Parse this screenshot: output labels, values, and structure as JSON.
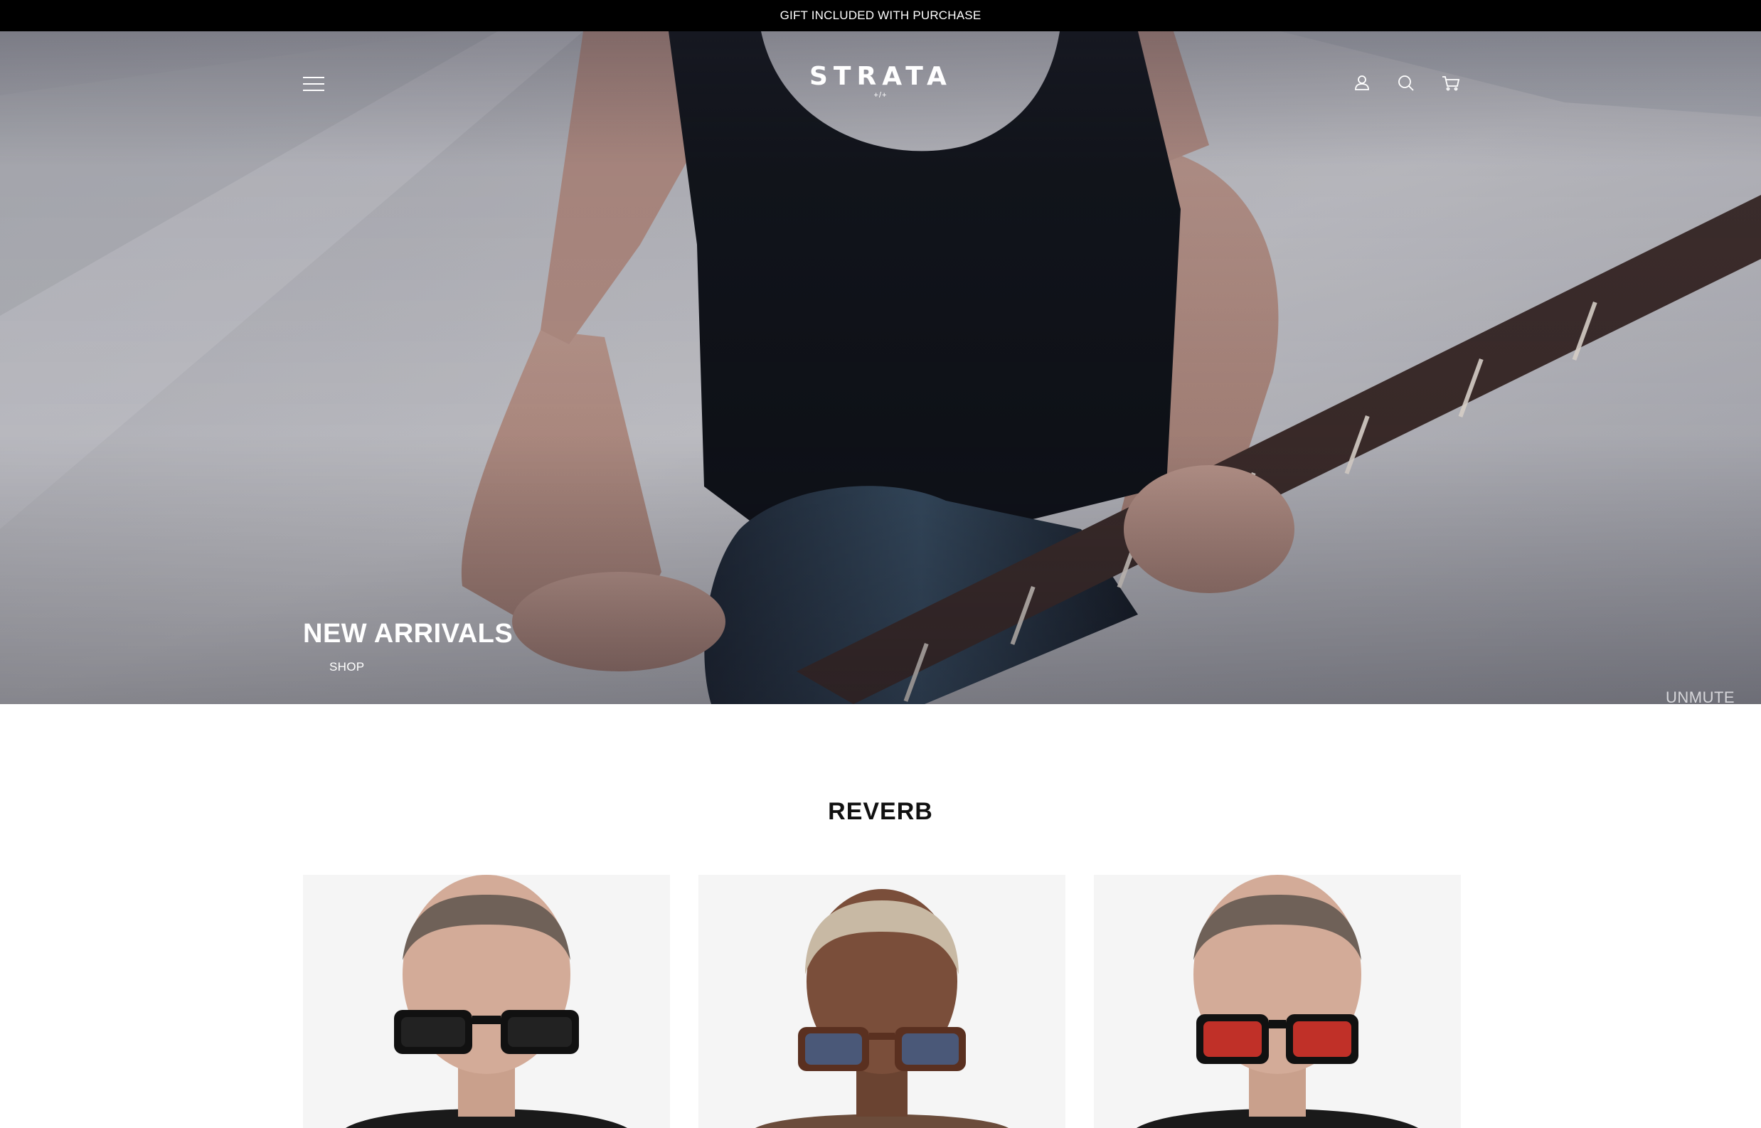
{
  "announcement": {
    "text": "GIFT INCLUDED WITH PURCHASE"
  },
  "header": {
    "logo_text": "STRATA",
    "logo_mark": "+/+",
    "icons": [
      "menu-icon",
      "account-icon",
      "search-icon",
      "cart-icon"
    ]
  },
  "hero": {
    "title": "NEW ARRIVALS",
    "link_label": "SHOP",
    "unmute_label": "UNMUTE"
  },
  "collection": {
    "title": "REVERB",
    "products": [
      {
        "lens_color": "#222222",
        "frame_color": "#111111"
      },
      {
        "lens_color": "#4a5878",
        "frame_color": "#5a3020"
      },
      {
        "lens_color": "#c03028",
        "frame_color": "#111111"
      }
    ]
  },
  "colors": {
    "announcement_bg": "#000000",
    "text_light": "#ffffff",
    "card_bg": "#f5f5f5"
  }
}
